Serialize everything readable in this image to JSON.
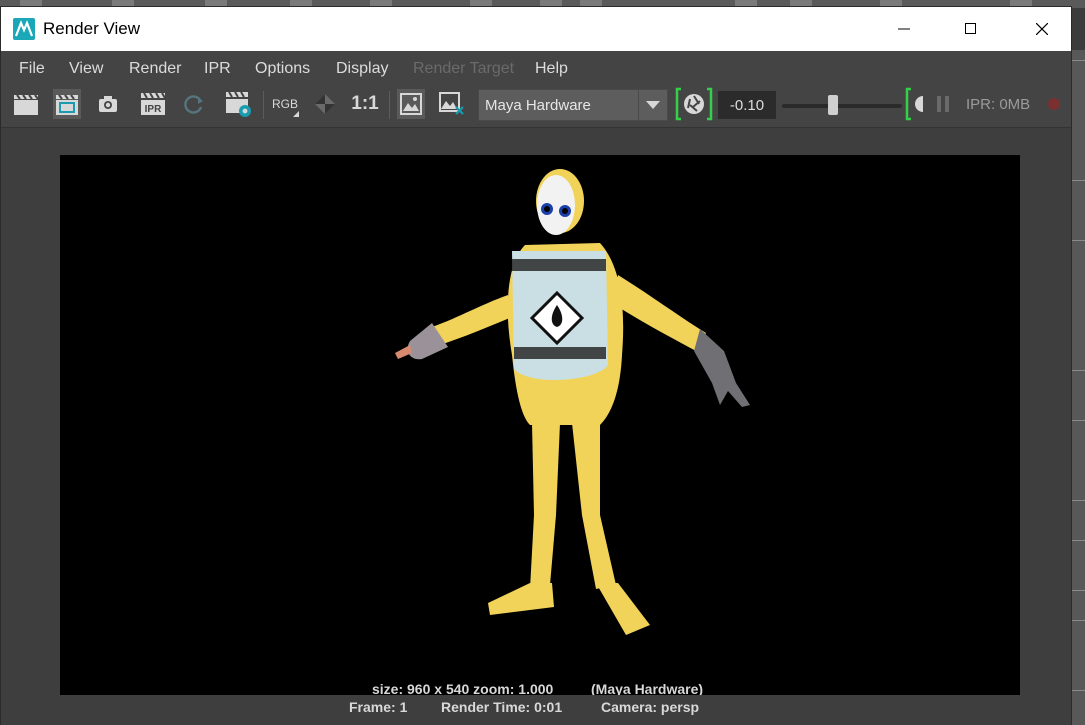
{
  "window": {
    "title": "Render View",
    "minimize_icon": "minimize-icon",
    "maximize_icon": "maximize-icon",
    "close_icon": "close-icon"
  },
  "menu": {
    "items": [
      {
        "label": "File",
        "enabled": true
      },
      {
        "label": "View",
        "enabled": true
      },
      {
        "label": "Render",
        "enabled": true
      },
      {
        "label": "IPR",
        "enabled": true
      },
      {
        "label": "Options",
        "enabled": true
      },
      {
        "label": "Display",
        "enabled": true
      },
      {
        "label": "Render Target",
        "enabled": false
      },
      {
        "label": "Help",
        "enabled": true
      }
    ]
  },
  "toolbar": {
    "rgb_label": "RGB",
    "ratio_label": "1:1",
    "ipr_label": "IPR",
    "renderer": "Maya Hardware",
    "exposure": "-0.10",
    "exposure_slider": 0.42,
    "ipr_memory": "IPR: 0MB"
  },
  "render_info": {
    "size": "size: 960 x 540 zoom: 1.000",
    "renderer": "(Maya Hardware)",
    "frame": "Frame: 1",
    "render_time": "Render Time: 0:01",
    "camera": "Camera: persp"
  },
  "colors": {
    "accent_green": "#33d04a",
    "suit_yellow": "#f2d65c",
    "vest_blue": "#c9dfe3"
  }
}
